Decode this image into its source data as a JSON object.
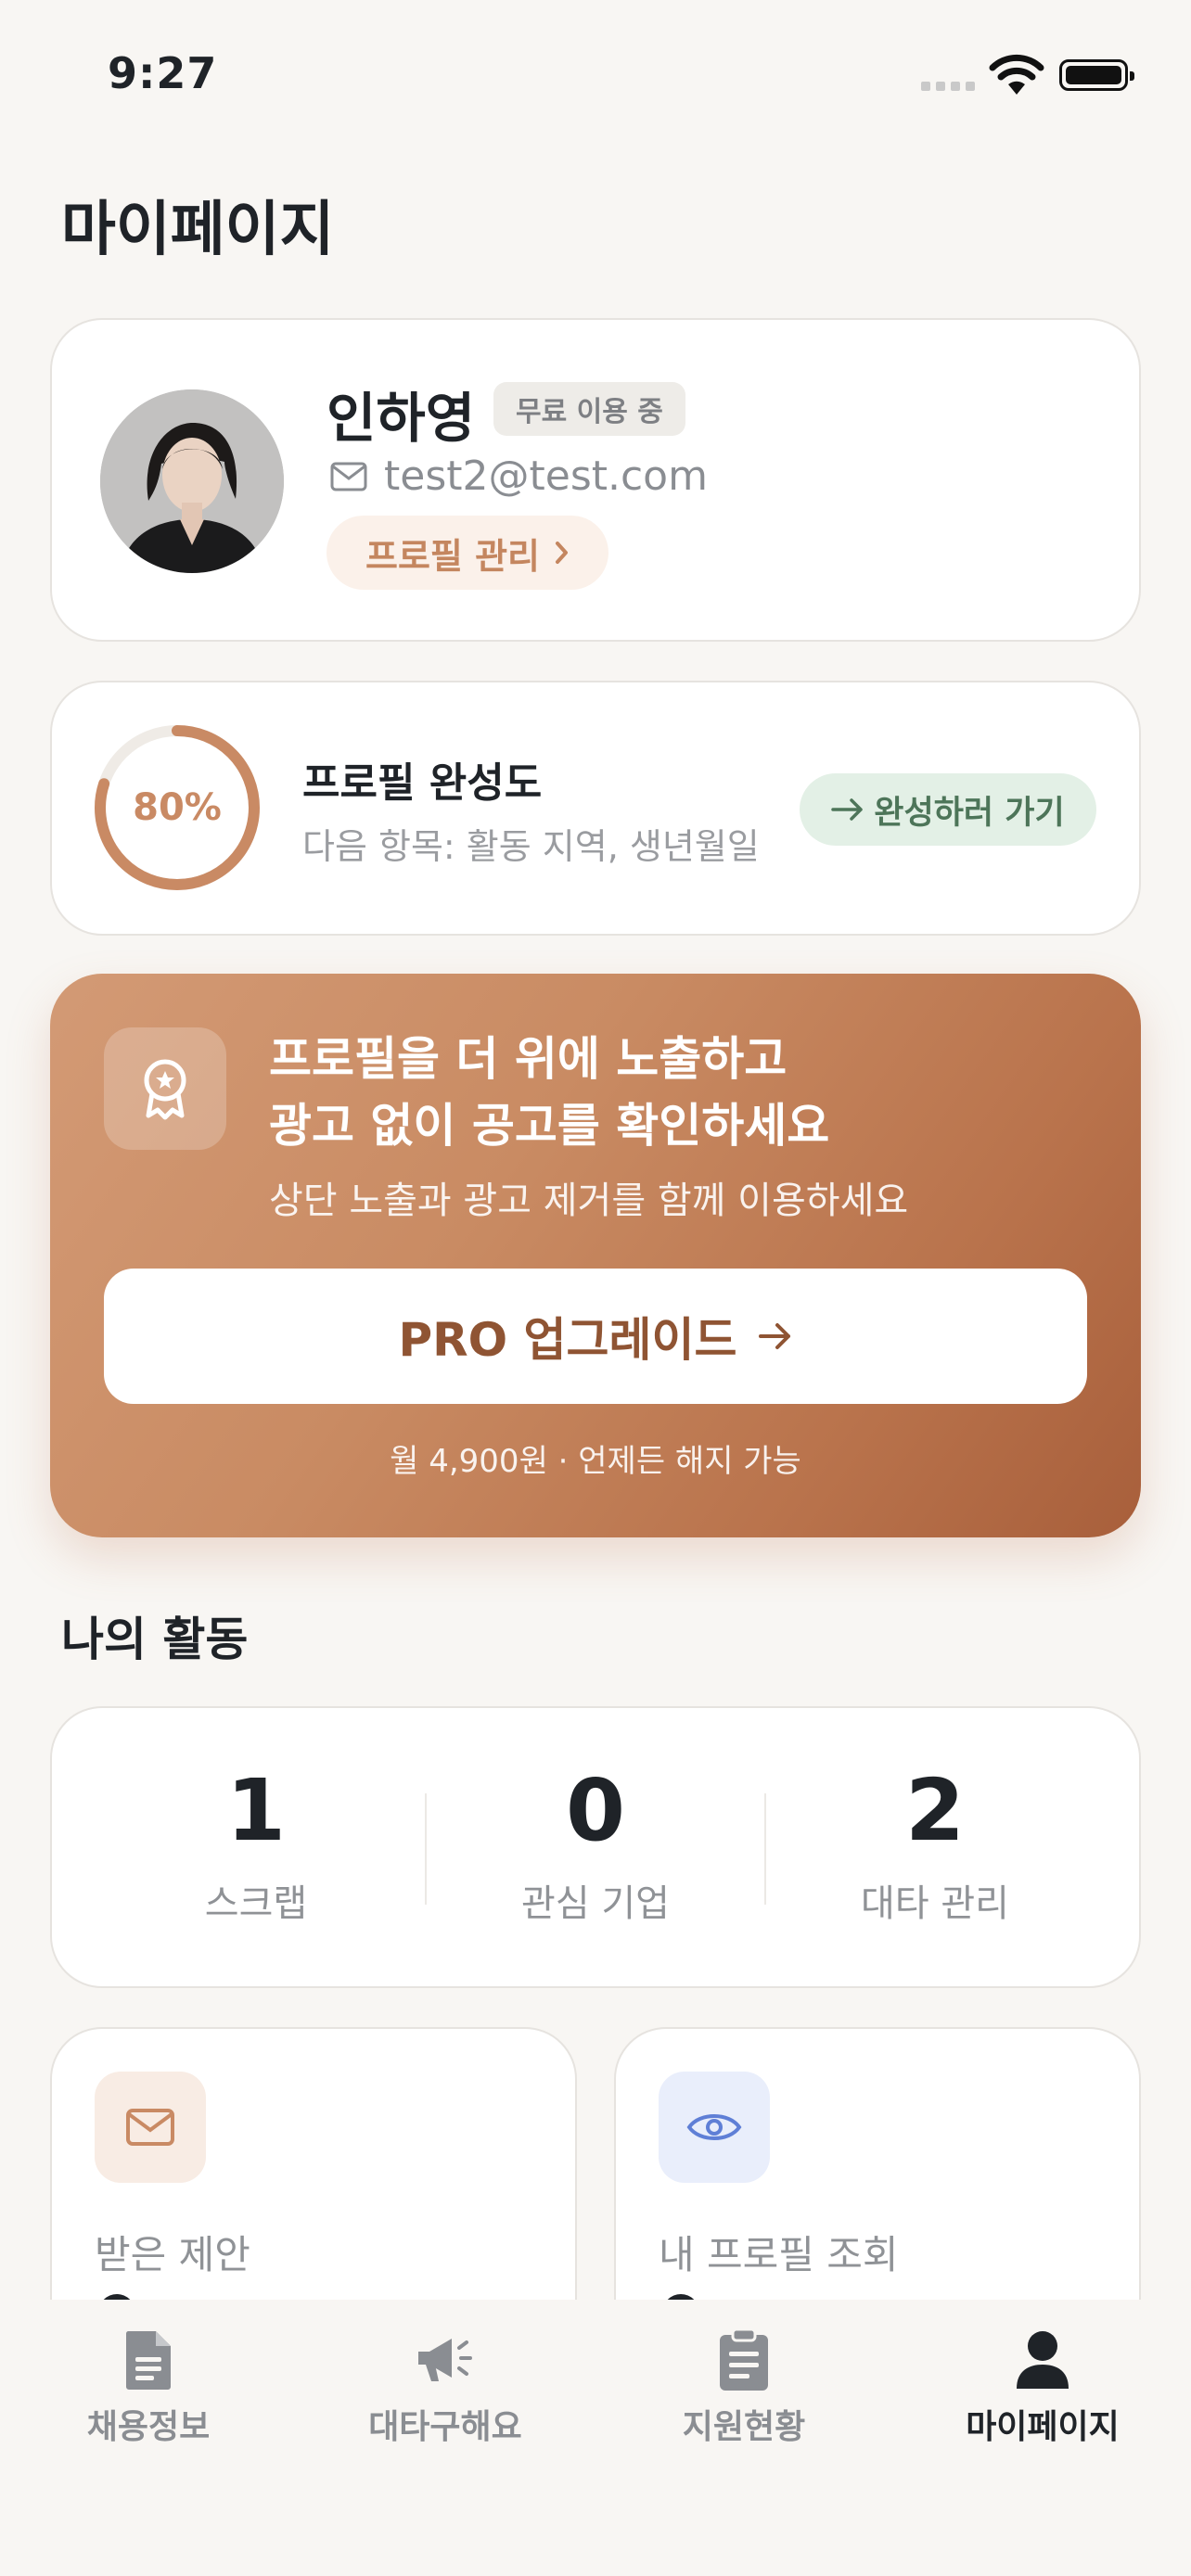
{
  "status_bar": {
    "time": "9:27"
  },
  "page": {
    "title": "마이페이지"
  },
  "profile": {
    "name": "인하영",
    "plan_badge": "무료 이용 중",
    "email": "test2@test.com",
    "manage_label": "프로필 관리"
  },
  "completion": {
    "percent_label": "80%",
    "percent_value": 80,
    "title": "프로필 완성도",
    "subtitle": "다음 항목: 활동 지역, 생년월일",
    "action_label": "완성하러 가기"
  },
  "promo": {
    "title_line1": "프로필을 더 위에 노출하고",
    "title_line2": "광고 없이 공고를 확인하세요",
    "subtitle": "상단 노출과 광고 제거를 함께 이용하세요",
    "button_label": "PRO 업그레이드",
    "price_note": "월 4,900원 · 언제든 해지 가능",
    "accent": "#c98b63"
  },
  "activity": {
    "section_title": "나의 활동",
    "stats": [
      {
        "value": "1",
        "label": "스크랩"
      },
      {
        "value": "0",
        "label": "관심 기업"
      },
      {
        "value": "2",
        "label": "대타 관리"
      }
    ],
    "cards": [
      {
        "label": "받은 제안",
        "icon": "mail-icon"
      },
      {
        "label": "내 프로필 조회",
        "icon": "eye-icon"
      }
    ]
  },
  "tabbar": {
    "tabs": [
      {
        "label": "채용정보",
        "icon": "document-icon"
      },
      {
        "label": "대타구해요",
        "icon": "megaphone-icon"
      },
      {
        "label": "지원현황",
        "icon": "clipboard-icon"
      },
      {
        "label": "마이페이지",
        "icon": "person-icon",
        "active": true
      }
    ]
  }
}
